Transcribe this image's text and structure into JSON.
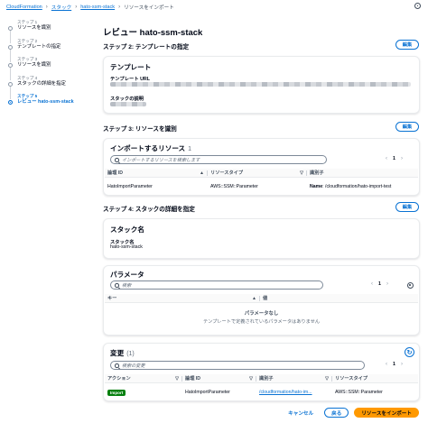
{
  "breadcrumb": {
    "items": [
      "CloudFormation",
      "スタック",
      "hato-ssm-stack"
    ],
    "current": "リソースをインポート"
  },
  "wizard": {
    "steps": [
      {
        "num": "ステップ 1",
        "label": "リソースを識別"
      },
      {
        "num": "ステップ 2",
        "label": "テンプレートの指定"
      },
      {
        "num": "ステップ 3",
        "label": "リソースを識別"
      },
      {
        "num": "ステップ 4",
        "label": "スタックの詳細を指定"
      },
      {
        "num": "ステップ 5",
        "label": "レビュー hato-ssm-stack"
      }
    ],
    "active_index": 4
  },
  "page_title": "レビュー hato-ssm-stack",
  "edit_label": "編集",
  "step2": {
    "title": "ステップ 2: テンプレートの指定",
    "panel_title": "テンプレート",
    "url_label": "テンプレート URL",
    "desc_label": "スタックの説明"
  },
  "step3": {
    "title": "ステップ 3: リソースを識別",
    "panel_title": "インポートするリソース",
    "count": "1",
    "search_placeholder": "インポートするリソースを検索します",
    "page": "1",
    "columns": [
      "論理 ID",
      "リソースタイプ",
      "識別子"
    ],
    "rows": [
      {
        "logical_id": "HatoImportParameter",
        "type": "AWS::SSM::Parameter",
        "id_key": "Name",
        "id_value": "/cloudformation/hato-import-test"
      }
    ]
  },
  "step4": {
    "title": "ステップ 4: スタックの詳細を指定",
    "stack_panel_title": "スタック名",
    "stack_name_label": "スタック名",
    "stack_name_value": "hato-ssm-stack",
    "params_title": "パラメータ",
    "params_search_placeholder": "検索",
    "page": "1",
    "params_columns": [
      "キー",
      "値"
    ],
    "empty_title": "パラメータなし",
    "empty_desc": "テンプレートで定義されているパラメータはありません"
  },
  "changes": {
    "title": "変更",
    "count": "(1)",
    "search_placeholder": "検索の変更",
    "page": "1",
    "columns": [
      "アクション",
      "論理 ID",
      "識別子",
      "リソースタイプ"
    ],
    "rows": [
      {
        "action": "Import",
        "logical_id": "HatoImportParameter",
        "identifier": "/cloudformation/hato-im...",
        "type": "AWS::SSM::Parameter"
      }
    ]
  },
  "footer": {
    "cancel": "キャンセル",
    "back": "戻る",
    "submit": "リソースをインポート"
  },
  "colors": {
    "link": "#0972d3",
    "primary_button": "#ff9900",
    "import_badge": "#037f0c"
  }
}
